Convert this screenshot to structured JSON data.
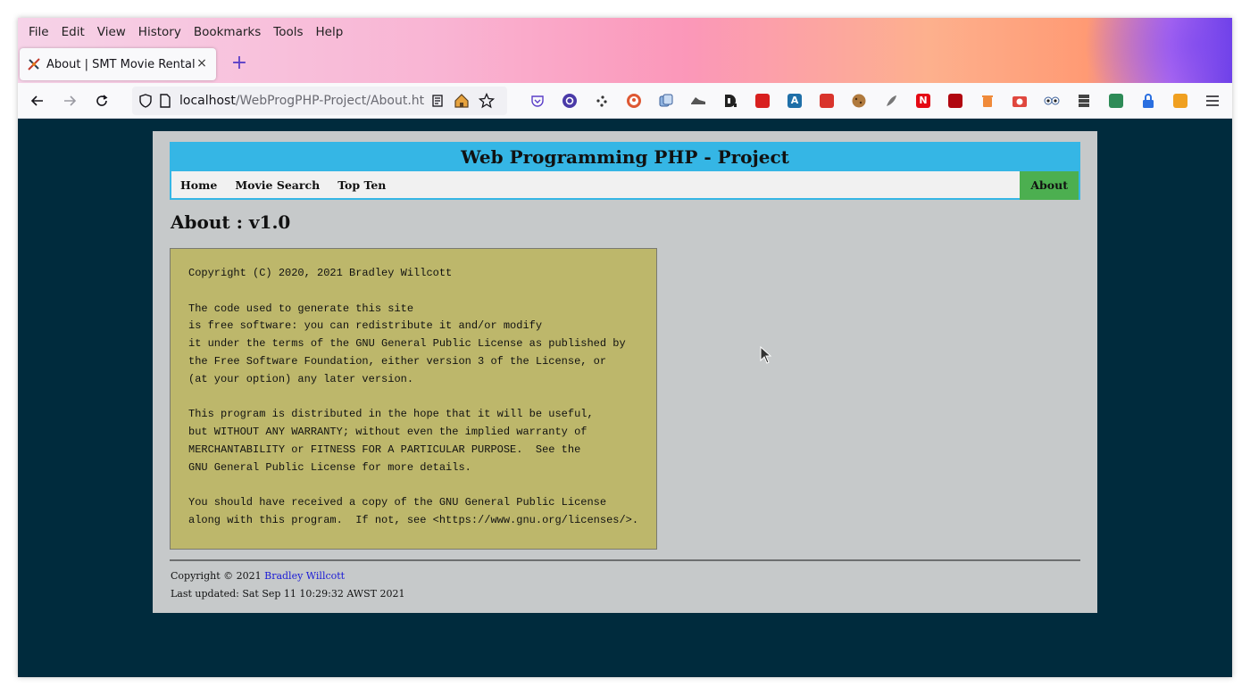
{
  "browser": {
    "menu": [
      "File",
      "Edit",
      "View",
      "History",
      "Bookmarks",
      "Tools",
      "Help"
    ],
    "tab": {
      "title": "About | SMT Movie Rental",
      "close": "×"
    },
    "new_tab": "+",
    "url": {
      "host": "localhost",
      "path": "/WebProgPHP-Project/About.htm"
    },
    "extension_icons": [
      "reader-view-icon",
      "home-icon",
      "bookmark-star-icon",
      "pocket-icon",
      "circle-extension-icon",
      "dots-extension-icon",
      "duckduckgo-icon",
      "tab-extension-icon",
      "shoe-extension-icon",
      "d-extension-icon",
      "magic-wand-icon",
      "a-extension-icon",
      "flash-icon",
      "cookie-icon",
      "feather-icon",
      "netflix-icon",
      "netflix-party-icon",
      "trash-icon",
      "camera-icon",
      "eyes-icon",
      "server-icon",
      "sheet-icon",
      "lock-icon",
      "lightning-icon",
      "menu-icon"
    ]
  },
  "site": {
    "title": "Web Programming PHP - Project",
    "nav": {
      "home": "Home",
      "movie_search": "Movie Search",
      "top_ten": "Top Ten",
      "about": "About"
    },
    "heading": "About : v1.0",
    "license_text": "Copyright (C) 2020, 2021 Bradley Willcott\n\nThe code used to generate this site\nis free software: you can redistribute it and/or modify\nit under the terms of the GNU General Public License as published by\nthe Free Software Foundation, either version 3 of the License, or\n(at your option) any later version.\n\nThis program is distributed in the hope that it will be useful,\nbut WITHOUT ANY WARRANTY; without even the implied warranty of\nMERCHANTABILITY or FITNESS FOR A PARTICULAR PURPOSE.  See the\nGNU General Public License for more details.\n\nYou should have received a copy of the GNU General Public License\nalong with this program.  If not, see <https://www.gnu.org/licenses/>.",
    "footer": {
      "copyright_prefix": "Copyright © 2021",
      "author_link": "Bradley Willcott",
      "last_updated": "Last updated: Sat Sep 11 10:29:32 AWST 2021"
    }
  },
  "colors": {
    "header_blue": "#35b6e5",
    "active_nav_green": "#4caf50",
    "license_bg": "#bdb76b",
    "page_bg": "#002b3d",
    "container_bg": "#c6c9ca"
  }
}
